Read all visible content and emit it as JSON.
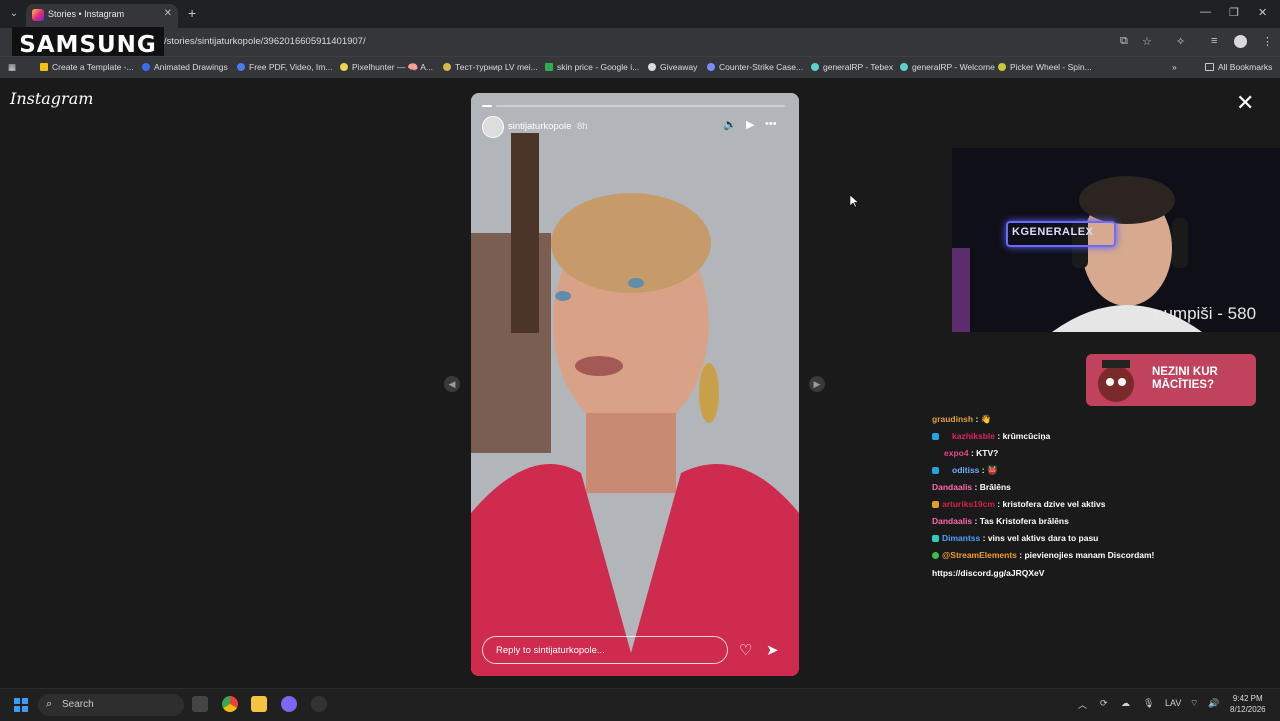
{
  "browser": {
    "tab_title": "Stories • Instagram",
    "url": "/stories/sintijaturkopole/3962016605911401907/",
    "watermark": "SAMSUNG",
    "bookmarks": [
      "Create a Template -...",
      "Animated Drawings",
      "Free PDF, Video, Im...",
      "Pixelhunter — 🧠 A...",
      "Тест-турнир LV mei...",
      "skin price - Google i...",
      "Giveaway",
      "Counter-Strike Case...",
      "generalRP - Tebex",
      "generalRP - Welcome",
      "Picker Wheel - Spin..."
    ],
    "all_bookmarks": "All Bookmarks"
  },
  "instagram": {
    "logo": "Instagram",
    "story": {
      "username": "sintijaturkopole",
      "time": "8h",
      "reply_placeholder": "Reply to sintijaturkopole..."
    }
  },
  "stream": {
    "webcam_label": "pumpiši - 580",
    "neon_sign": "KGENERALEX",
    "promo": "NEZINI KUR MĀCĪTIES?",
    "chat": [
      {
        "user": "graudinsh",
        "text": "👋",
        "color": "#e0a23a"
      },
      {
        "user": "kazhiksble",
        "text": "krūmcūciņa",
        "color": "#e0245e"
      },
      {
        "user": "expo4",
        "text": "KTV?",
        "color": "#e04a8a"
      },
      {
        "user": "oditiss",
        "text": "👹",
        "color": "#6ab0ff"
      },
      {
        "user": "Dandaalis",
        "text": "Brālēns",
        "color": "#ff6ab0"
      },
      {
        "user": "arturiks19cm",
        "text": "kristofera dzive vel aktivs",
        "color": "#d2224a"
      },
      {
        "user": "Dandaalis",
        "text": "Tas Kristofera brālēns",
        "color": "#ff6ab0"
      },
      {
        "user": "Dimantss",
        "text": "vins vel aktivs dara to pasu",
        "color": "#4aa0ff"
      },
      {
        "user": "@StreamElements",
        "text": "pievienojies manam Discordam!",
        "color": "#f0a030"
      }
    ],
    "chat_link": "https://discord.gg/aJRQXeV"
  },
  "taskbar": {
    "search": "Search",
    "language": "LAV",
    "time": "9:42 PM",
    "date": "8/12/2026"
  }
}
